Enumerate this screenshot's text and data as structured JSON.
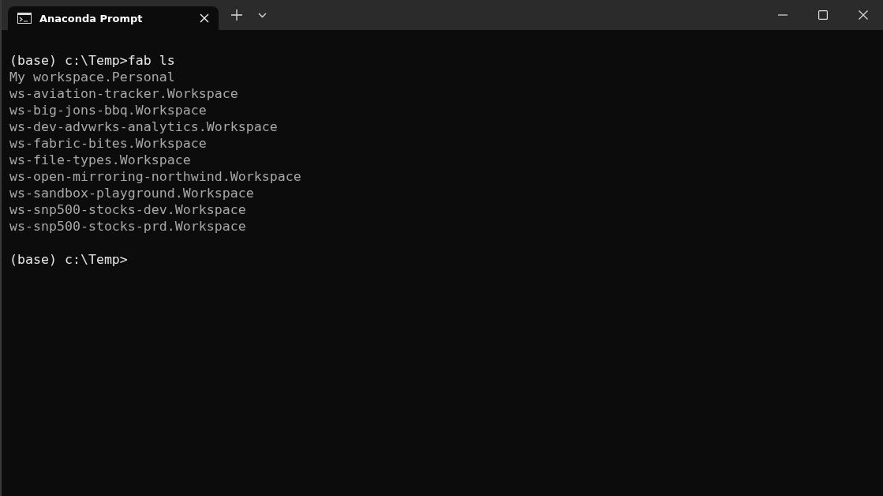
{
  "tabs": [
    {
      "label": "Anaconda Prompt",
      "selected": true
    }
  ],
  "terminal": {
    "lines": [
      {
        "kind": "prompt",
        "text": "(base) c:\\Temp>fab ls"
      },
      {
        "kind": "output",
        "text": "My workspace.Personal"
      },
      {
        "kind": "output",
        "text": "ws-aviation-tracker.Workspace"
      },
      {
        "kind": "output",
        "text": "ws-big-jons-bbq.Workspace"
      },
      {
        "kind": "output",
        "text": "ws-dev-advwrks-analytics.Workspace"
      },
      {
        "kind": "output",
        "text": "ws-fabric-bites.Workspace"
      },
      {
        "kind": "output",
        "text": "ws-file-types.Workspace"
      },
      {
        "kind": "output",
        "text": "ws-open-mirroring-northwind.Workspace"
      },
      {
        "kind": "output",
        "text": "ws-sandbox-playground.Workspace"
      },
      {
        "kind": "output",
        "text": "ws-snp500-stocks-dev.Workspace"
      },
      {
        "kind": "output",
        "text": "ws-snp500-stocks-prd.Workspace"
      },
      {
        "kind": "blank"
      },
      {
        "kind": "prompt",
        "text": "(base) c:\\Temp>"
      }
    ]
  }
}
